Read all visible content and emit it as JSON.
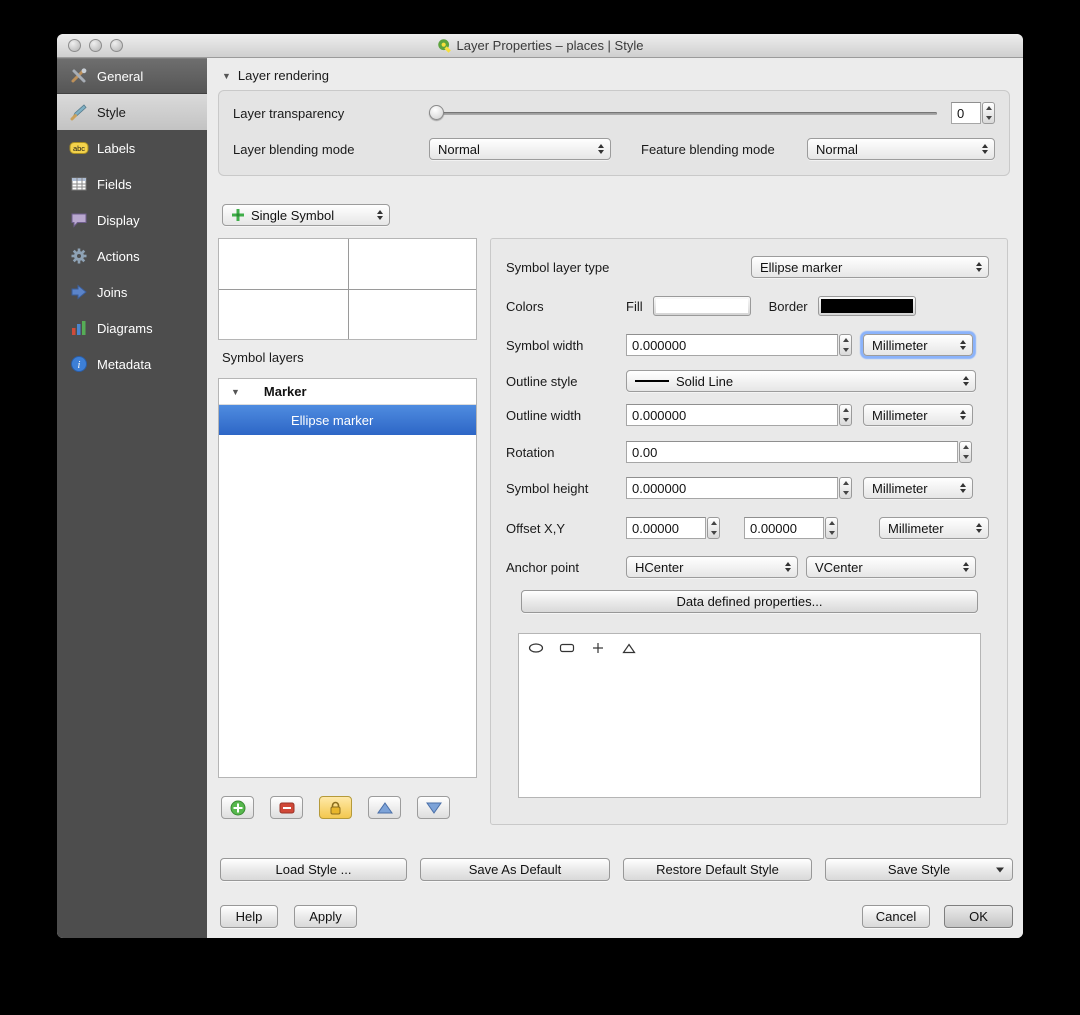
{
  "window": {
    "title": "Layer Properties – places | Style",
    "icon": "qgis-logo-icon"
  },
  "sidebar": {
    "items": [
      {
        "label": "General",
        "icon": "tools-icon"
      },
      {
        "label": "Style",
        "icon": "paintbrush-icon"
      },
      {
        "label": "Labels",
        "icon": "abc-label-icon"
      },
      {
        "label": "Fields",
        "icon": "table-icon"
      },
      {
        "label": "Display",
        "icon": "speech-bubble-icon"
      },
      {
        "label": "Actions",
        "icon": "gear-icon"
      },
      {
        "label": "Joins",
        "icon": "join-arrow-icon"
      },
      {
        "label": "Diagrams",
        "icon": "bar-chart-icon"
      },
      {
        "label": "Metadata",
        "icon": "info-icon"
      }
    ],
    "selected": "Style"
  },
  "layer_rendering": {
    "header": "Layer rendering",
    "transparency": {
      "label": "Layer transparency",
      "value": "0"
    },
    "layer_blending": {
      "label": "Layer blending mode",
      "value": "Normal"
    },
    "feature_blending": {
      "label": "Feature blending mode",
      "value": "Normal"
    }
  },
  "renderer": {
    "value": "Single Symbol"
  },
  "symbol_layers": {
    "label": "Symbol layers",
    "group": "Marker",
    "selected": "Ellipse marker",
    "selection_color": "#3875d7"
  },
  "form": {
    "symbol_layer_type": {
      "label": "Symbol layer type",
      "value": "Ellipse marker"
    },
    "colors": {
      "label": "Colors",
      "fill_label": "Fill",
      "fill_color": "#ffffff",
      "border_label": "Border",
      "border_color": "#000000"
    },
    "symbol_width": {
      "label": "Symbol width",
      "value": "0.000000",
      "unit": "Millimeter"
    },
    "outline_style": {
      "label": "Outline style",
      "value": "Solid Line"
    },
    "outline_width": {
      "label": "Outline width",
      "value": "0.000000",
      "unit": "Millimeter"
    },
    "rotation": {
      "label": "Rotation",
      "value": "0.00"
    },
    "symbol_height": {
      "label": "Symbol height",
      "value": "0.000000",
      "unit": "Millimeter"
    },
    "offset": {
      "label": "Offset X,Y",
      "x": "0.00000",
      "y": "0.00000",
      "unit": "Millimeter"
    },
    "anchor": {
      "label": "Anchor point",
      "h": "HCenter",
      "v": "VCenter"
    },
    "data_defined_button": "Data defined properties...",
    "shape_options": [
      "ellipse",
      "rectangle",
      "cross",
      "triangle"
    ]
  },
  "footer": {
    "load_style": "Load Style ...",
    "save_as_default": "Save As Default",
    "restore_default": "Restore Default Style",
    "save_style": "Save Style",
    "help": "Help",
    "apply": "Apply",
    "cancel": "Cancel",
    "ok": "OK"
  }
}
